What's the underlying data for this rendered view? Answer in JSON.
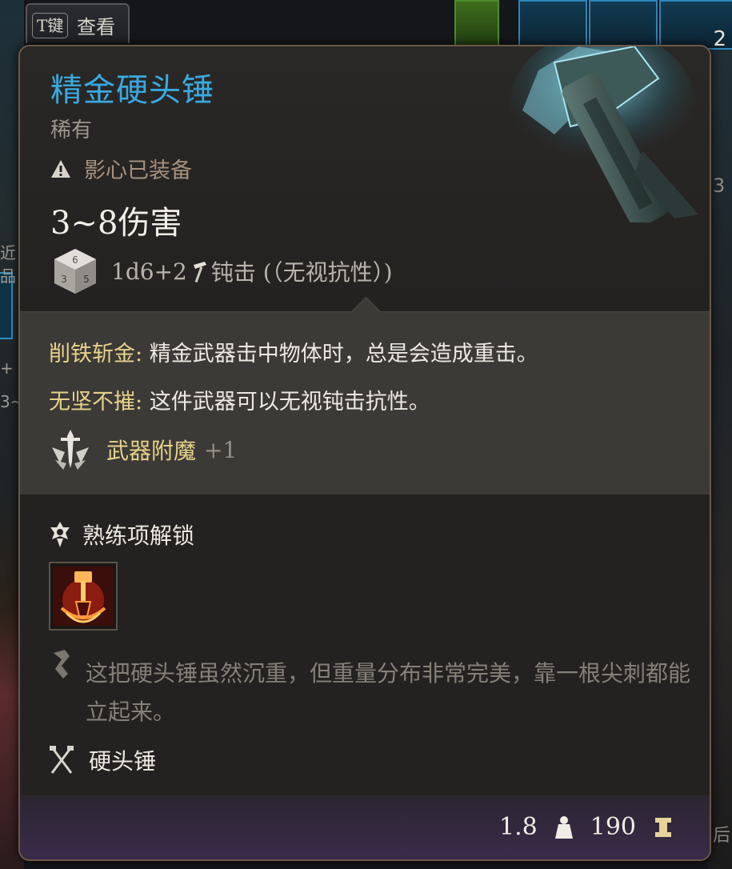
{
  "view_button": {
    "key": "T键",
    "label": "查看"
  },
  "background": {
    "slot_count": "2",
    "left_fragments": [
      "近品",
      "+",
      "3~"
    ],
    "right_fragments": [
      "3",
      "2",
      "后"
    ]
  },
  "item": {
    "name": "精金硬头锤",
    "rarity": "稀有",
    "equipped_by": "影心已装备",
    "damage": "3~8伤害",
    "dice_formula": "1d6+2",
    "damage_type": "钝击 (（无视抗性）)",
    "properties": [
      {
        "name": "削铁斩金:",
        "desc": " 精金武器击中物体时，总是会造成重击。"
      },
      {
        "name": "无坚不摧:",
        "desc": " 这件武器可以无视钝击抗性。"
      }
    ],
    "enchantment": {
      "label": "武器附魔",
      "value": "+1"
    },
    "proficiency_label": "熟练项解锁",
    "flavor_text": "这把硬头锤虽然沉重，但重量分布非常完美，靠一根尖刺都能立起来。",
    "weapon_type": "硬头锤",
    "weight": "1.8",
    "value": "190"
  },
  "colors": {
    "title": "#39a9e0",
    "property_name": "#e7d28a",
    "panel_border": "#6b5847",
    "footer_purple": "#3b2a4a"
  },
  "icons": {
    "warning": "warning-triangle-icon",
    "dice": "d6-dice-icon",
    "damage_type": "hammer-icon",
    "enchant": "sword-emblem-icon",
    "proficiency": "proficiency-badge-icon",
    "flavor": "quill-icon",
    "weapon_type": "crossed-weapons-icon",
    "weight": "weight-icon",
    "gold": "gold-coin-icon"
  }
}
